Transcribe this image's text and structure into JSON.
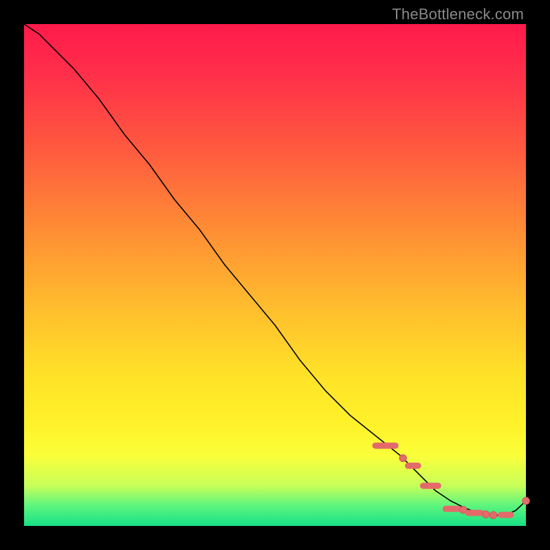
{
  "watermark": "TheBottleneck.com",
  "colors": {
    "background": "#000000",
    "curve": "#000000",
    "marker": "#e46a6a",
    "gradient_top": "#ff1a4b",
    "gradient_bottom": "#17e086"
  },
  "chart_data": {
    "type": "line",
    "title": "",
    "xlabel": "",
    "ylabel": "",
    "xlim": [
      0,
      100
    ],
    "ylim": [
      0,
      100
    ],
    "series": [
      {
        "name": "bottleneck-curve",
        "x": [
          0,
          3,
          6,
          10,
          15,
          20,
          25,
          30,
          35,
          40,
          45,
          50,
          55,
          60,
          65,
          70,
          75,
          80,
          82,
          85,
          88,
          90,
          92,
          94,
          96,
          98,
          100
        ],
        "values": [
          100,
          98,
          95,
          91,
          85,
          78,
          72,
          65,
          59,
          52,
          46,
          40,
          33,
          27,
          22,
          18,
          14,
          9,
          7,
          5,
          3.5,
          2.8,
          2.3,
          2.1,
          2.2,
          3.1,
          5
        ]
      }
    ],
    "markers": [
      {
        "type": "dash",
        "x0": 70,
        "x1": 74,
        "y": 16
      },
      {
        "type": "dot",
        "x": 75.5,
        "y": 13.5
      },
      {
        "type": "dash",
        "x0": 76.5,
        "x1": 78.5,
        "y": 12
      },
      {
        "type": "dash",
        "x0": 79.5,
        "x1": 82.5,
        "y": 8
      },
      {
        "type": "dash",
        "x0": 84,
        "x1": 86.5,
        "y": 3.4
      },
      {
        "type": "dot",
        "x": 87.5,
        "y": 3.2
      },
      {
        "type": "dash",
        "x0": 88.5,
        "x1": 91,
        "y": 2.6
      },
      {
        "type": "dot",
        "x": 92,
        "y": 2.3
      },
      {
        "type": "dot",
        "x": 93.5,
        "y": 2.15
      },
      {
        "type": "dash",
        "x0": 95,
        "x1": 97,
        "y": 2.2
      },
      {
        "type": "dot",
        "x": 100,
        "y": 5
      }
    ]
  }
}
